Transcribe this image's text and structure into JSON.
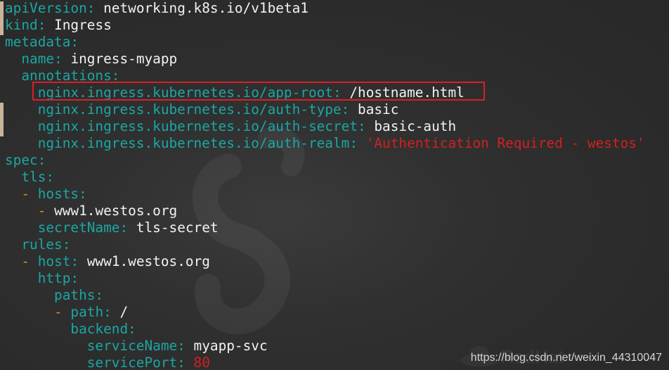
{
  "editor": {
    "theme_colors": {
      "background": "#2b2b2b",
      "key": "#1aa7a3",
      "value": "#f2f2f2",
      "dash": "#d98a19",
      "string": "#d32020",
      "highlight_box": "#d6202a"
    },
    "lines": [
      {
        "indent": "",
        "key": "apiVersion",
        "value": "networking.k8s.io/v1beta1"
      },
      {
        "indent": "",
        "key": "kind",
        "value": "Ingress"
      },
      {
        "indent": "",
        "key": "metadata"
      },
      {
        "indent": "  ",
        "key": "name",
        "value": "ingress-myapp"
      },
      {
        "indent": "  ",
        "key": "annotations"
      },
      {
        "indent": "    ",
        "key": "nginx.ingress.kubernetes.io/app-root",
        "value": "/hostname.html"
      },
      {
        "indent": "    ",
        "key": "nginx.ingress.kubernetes.io/auth-type",
        "value": "basic"
      },
      {
        "indent": "    ",
        "key": "nginx.ingress.kubernetes.io/auth-secret",
        "value": "basic-auth"
      },
      {
        "indent": "    ",
        "key": "nginx.ingress.kubernetes.io/auth-realm",
        "string": "'Authentication Required - westos'"
      },
      {
        "indent": "",
        "key": "spec"
      },
      {
        "indent": "  ",
        "key": "tls"
      },
      {
        "indent": "  ",
        "dash": "-",
        "key": "hosts"
      },
      {
        "indent": "    ",
        "dash": "-",
        "value": "www1.westos.org"
      },
      {
        "indent": "    ",
        "key": "secretName",
        "value": "tls-secret"
      },
      {
        "indent": "  ",
        "key": "rules"
      },
      {
        "indent": "  ",
        "dash": "-",
        "key": "host",
        "value": "www1.westos.org"
      },
      {
        "indent": "    ",
        "key": "http"
      },
      {
        "indent": "      ",
        "key": "paths"
      },
      {
        "indent": "      ",
        "dash": "-",
        "key": "path",
        "value": "/"
      },
      {
        "indent": "        ",
        "key": "backend"
      },
      {
        "indent": "          ",
        "key": "serviceName",
        "value": "myapp-svc"
      },
      {
        "indent": "          ",
        "key": "servicePort",
        "string": "80"
      }
    ]
  },
  "watermark": {
    "url_text": "https://blog.csdn.net/weixin_44310047",
    "brand_text": "RedHat"
  }
}
